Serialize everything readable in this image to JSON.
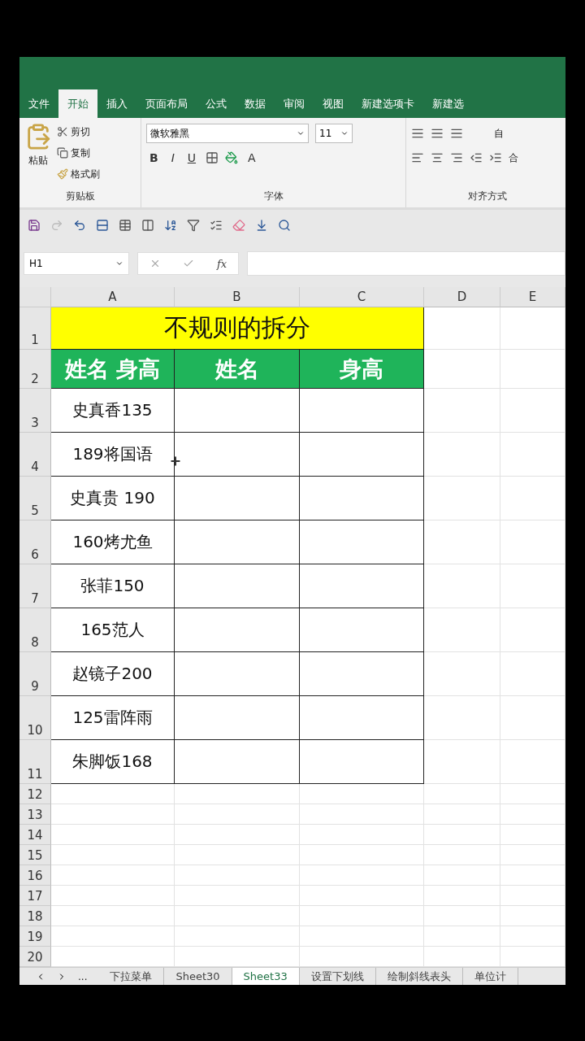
{
  "ribbon_tabs": [
    {
      "label": "文件",
      "selected": false
    },
    {
      "label": "开始",
      "selected": true
    },
    {
      "label": "插入",
      "selected": false
    },
    {
      "label": "页面布局",
      "selected": false
    },
    {
      "label": "公式",
      "selected": false
    },
    {
      "label": "数据",
      "selected": false
    },
    {
      "label": "审阅",
      "selected": false
    },
    {
      "label": "视图",
      "selected": false
    },
    {
      "label": "新建选项卡",
      "selected": false
    },
    {
      "label": "新建选",
      "selected": false
    }
  ],
  "clipboard": {
    "paste": "粘贴",
    "cut": "剪切",
    "copy": "复制",
    "format_painter": "格式刷",
    "group": "剪贴板"
  },
  "font": {
    "name": "微软雅黑",
    "size": "11",
    "bold": "B",
    "italic": "I",
    "underline": "U",
    "font_color": "A",
    "group": "字体"
  },
  "alignment": {
    "wrap": "自",
    "merge": "合",
    "group": "对齐方式"
  },
  "name_box": "H1",
  "fx": "fx",
  "columns": [
    "A",
    "B",
    "C",
    "D",
    "E"
  ],
  "title": "不规则的拆分",
  "headers": [
    "姓名 身高",
    "姓名",
    "身高"
  ],
  "rows": [
    {
      "a": "史真香135"
    },
    {
      "a": "189将国语"
    },
    {
      "a": "史真贵 190"
    },
    {
      "a": "160烤尤鱼"
    },
    {
      "a": "张菲150"
    },
    {
      "a": "165范人"
    },
    {
      "a": "赵镜子200"
    },
    {
      "a": "125雷阵雨"
    },
    {
      "a": "朱脚饭168"
    }
  ],
  "row_numbers": [
    "1",
    "2",
    "3",
    "4",
    "5",
    "6",
    "7",
    "8",
    "9",
    "10",
    "11",
    "12",
    "13",
    "14",
    "15",
    "16",
    "17",
    "18",
    "19",
    "20"
  ],
  "sheet_more": "...",
  "sheet_tabs": [
    {
      "label": "下拉菜单",
      "selected": false
    },
    {
      "label": "Sheet30",
      "selected": false
    },
    {
      "label": "Sheet33",
      "selected": true
    },
    {
      "label": "设置下划线",
      "selected": false
    },
    {
      "label": "绘制斜线表头",
      "selected": false
    },
    {
      "label": "单位计",
      "selected": false
    }
  ]
}
